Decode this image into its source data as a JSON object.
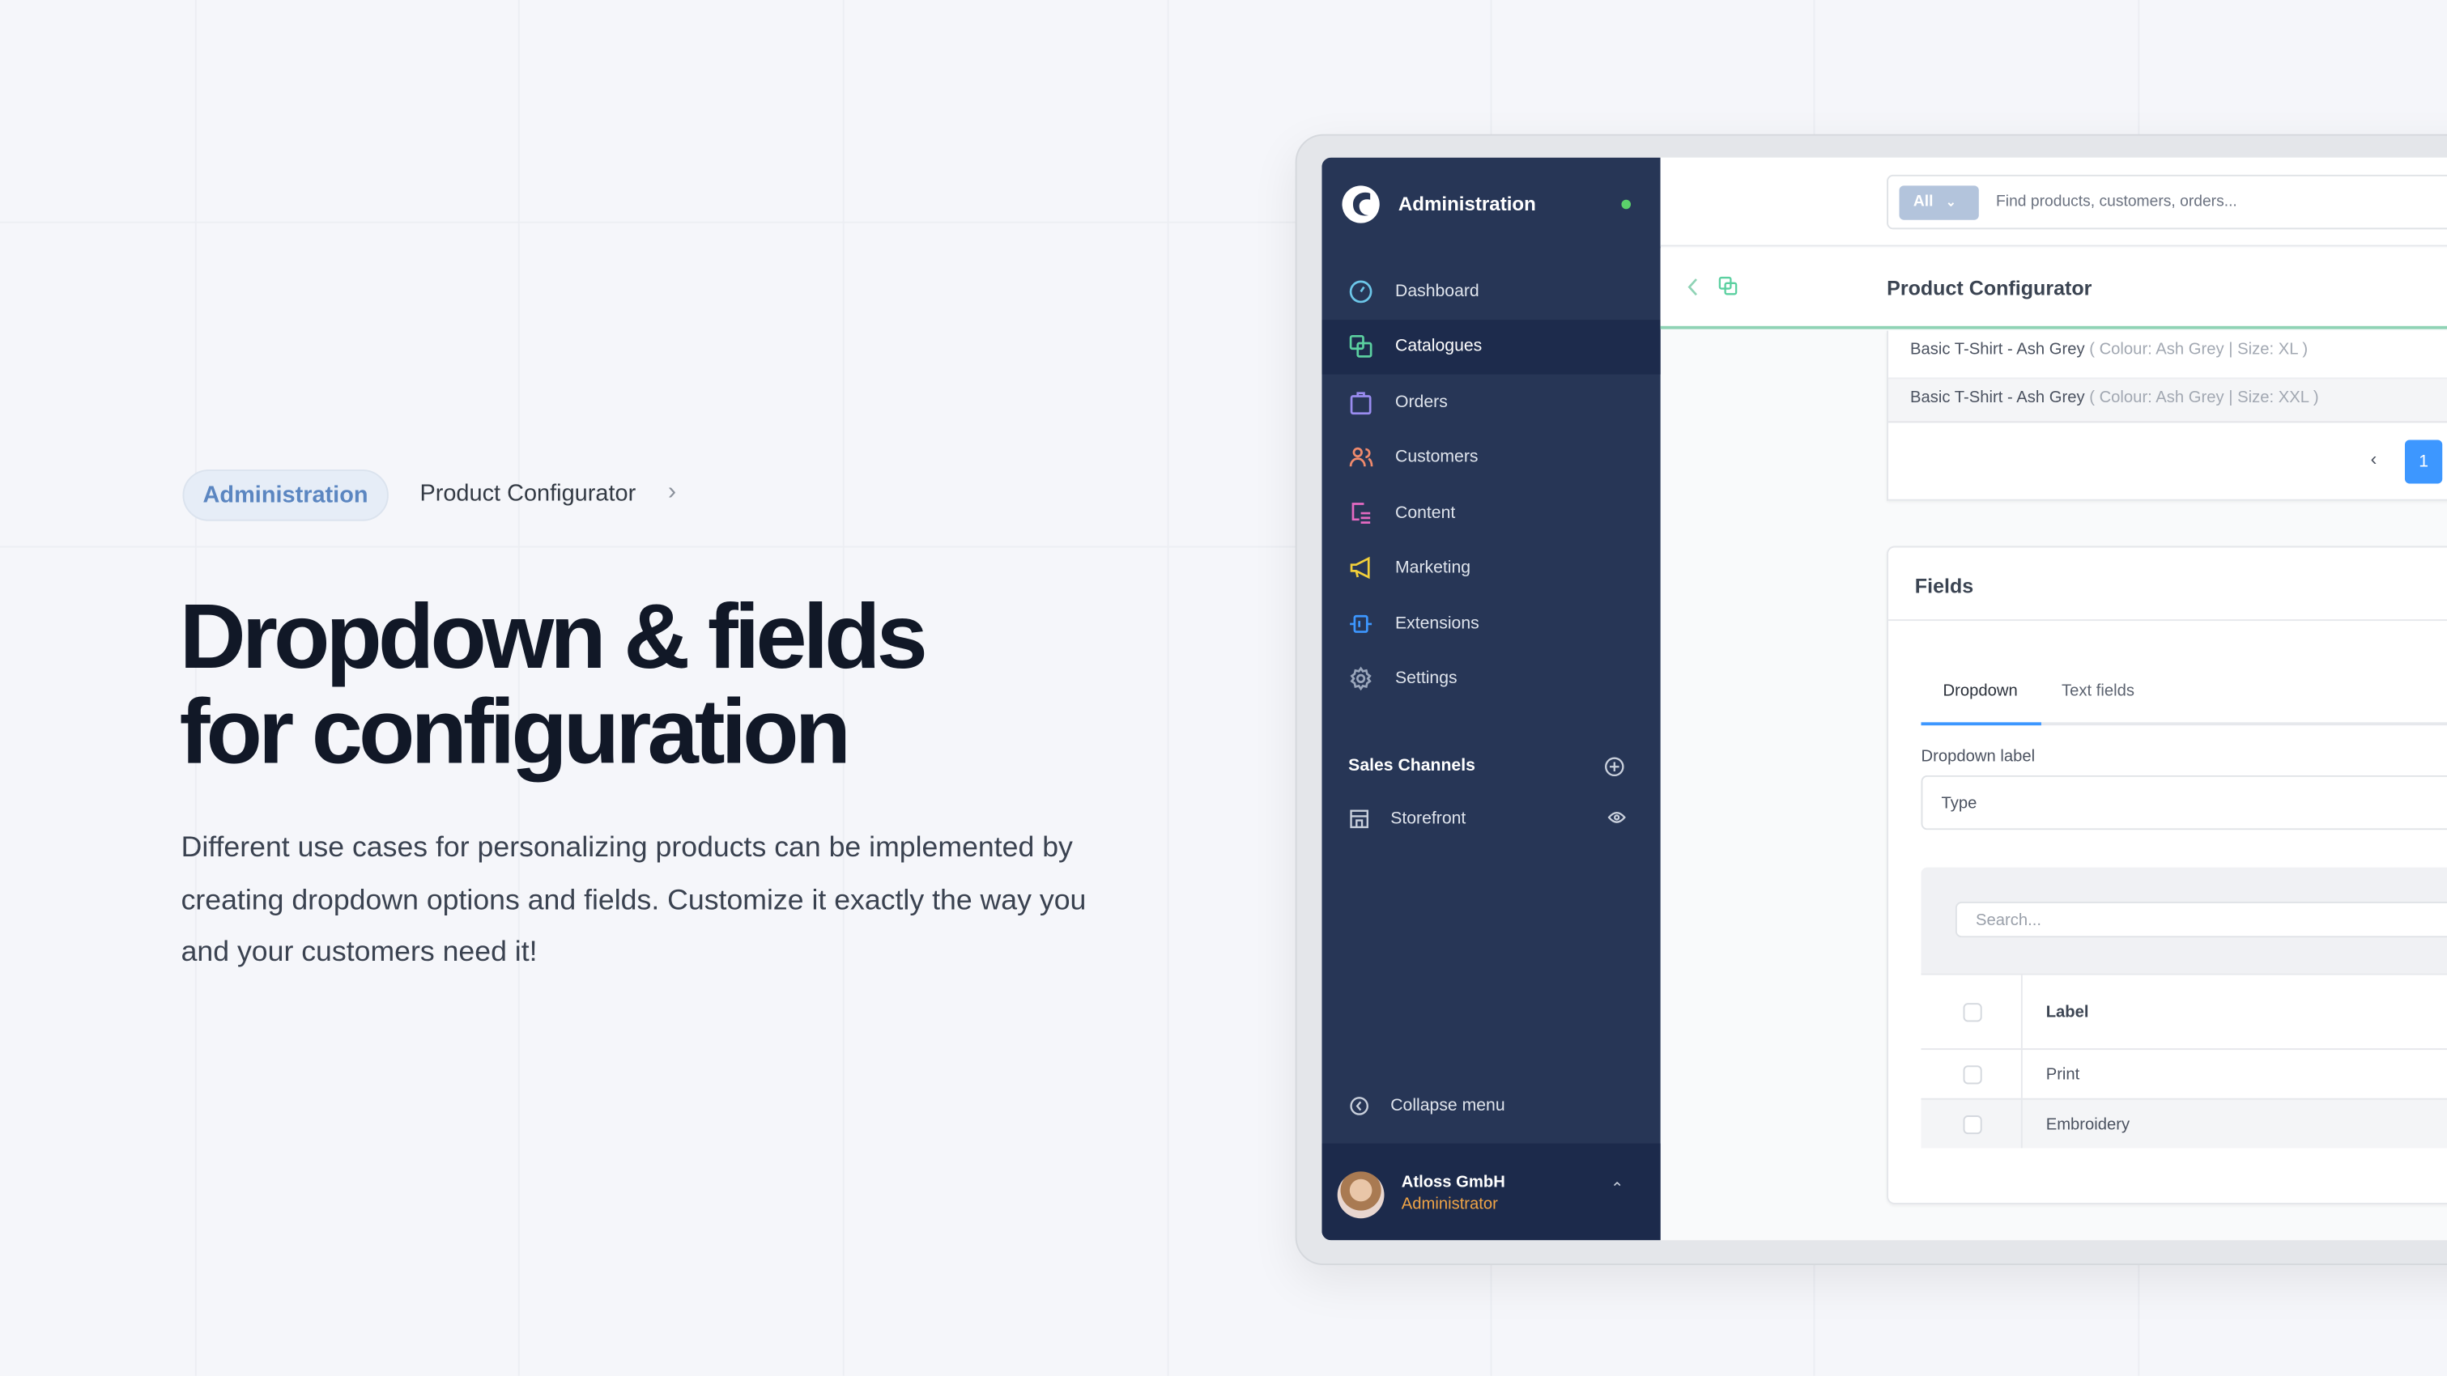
{
  "breadcrumb": {
    "items": [
      "Administration",
      "Product Configurator"
    ]
  },
  "hero": {
    "title_line1": "Dropdown & fields",
    "title_line2": "for configuration",
    "description": "Different use cases for personalizing products can be implemented by creating dropdown options and fields. Customize it exactly the way you and your customers need it!"
  },
  "sidebar": {
    "brand": "Administration",
    "status_color": "#5bd06b",
    "items": [
      {
        "label": "Dashboard",
        "icon": "gauge-icon",
        "color": "#6cc6e8"
      },
      {
        "label": "Catalogues",
        "icon": "catalogue-icon",
        "color": "#5bd0a0",
        "active": true
      },
      {
        "label": "Orders",
        "icon": "bag-icon",
        "color": "#9a8cf0"
      },
      {
        "label": "Customers",
        "icon": "users-icon",
        "color": "#f08a6c"
      },
      {
        "label": "Content",
        "icon": "content-icon",
        "color": "#e46ac2"
      },
      {
        "label": "Marketing",
        "icon": "megaphone-icon",
        "color": "#f2cf3a"
      },
      {
        "label": "Extensions",
        "icon": "plug-icon",
        "color": "#3d97ff"
      },
      {
        "label": "Settings",
        "icon": "gear-icon",
        "color": "#9aa6bb"
      }
    ],
    "sales_channels_label": "Sales Channels",
    "storefront_label": "Storefront",
    "collapse_label": "Collapse menu",
    "user": {
      "name": "Atloss GmbH",
      "role": "Administrator"
    }
  },
  "topbar": {
    "filter": "All",
    "search_placeholder": "Find products, customers, orders..."
  },
  "header": {
    "title": "Product Configurator"
  },
  "variants": [
    {
      "name": "Basic T-Shirt - Ash Grey",
      "options": "( Colour: Ash Grey | Size: XL )"
    },
    {
      "name": "Basic T-Shirt - Ash Grey",
      "options": "( Colour: Ash Grey | Size: XXL )"
    }
  ],
  "pagination": {
    "prev": "‹",
    "current": "1"
  },
  "fields": {
    "title": "Fields",
    "tabs": [
      "Dropdown",
      "Text fields"
    ],
    "dropdown_label": "Dropdown label",
    "dropdown_value": "Type",
    "search_placeholder": "Search...",
    "table_header": "Label",
    "rows": [
      "Print",
      "Embroidery"
    ]
  },
  "colors": {
    "accent": "#3d97ff",
    "sidebar": "#273656",
    "header_border": "#8fd3b5"
  }
}
